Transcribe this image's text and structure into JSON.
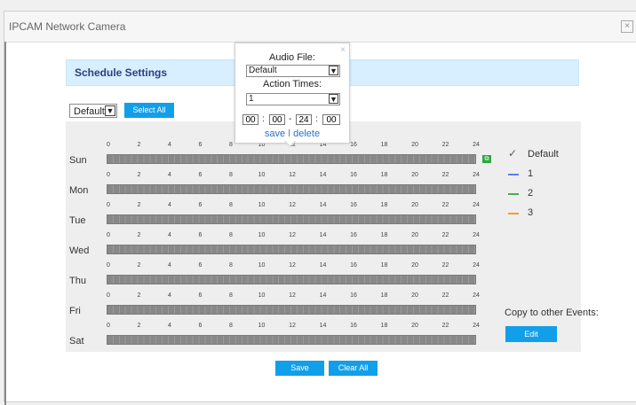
{
  "window": {
    "title": "IPCAM Network Camera",
    "close_glyph": "×"
  },
  "schedule": {
    "header": "Schedule Settings",
    "preset_select": "Default",
    "select_all": "Select All",
    "days": [
      "Sun",
      "Mon",
      "Tue",
      "Wed",
      "Thu",
      "Fri",
      "Sat"
    ],
    "ticks": [
      "0",
      "2",
      "4",
      "6",
      "8",
      "10",
      "12",
      "14",
      "16",
      "18",
      "20",
      "22",
      "24"
    ],
    "copy_icon": "copy-icon"
  },
  "legend": {
    "items": [
      {
        "label": "Default",
        "color": "#5a5a5a",
        "icon": "check-icon"
      },
      {
        "label": "1",
        "color": "#5b7ff0"
      },
      {
        "label": "2",
        "color": "#3db24a"
      },
      {
        "label": "3",
        "color": "#f0a030"
      }
    ],
    "copy_label": "Copy to other Events:",
    "edit_button": "Edit"
  },
  "popup": {
    "close": "×",
    "audio_file_label": "Audio File:",
    "audio_file_value": "Default",
    "action_times_label": "Action Times:",
    "action_times_value": "1",
    "start_hour": "00",
    "start_min": "00",
    "end_hour": "24",
    "end_min": "00",
    "colon": ":",
    "dash": "-",
    "save": "save",
    "divider": "|",
    "delete": "delete"
  },
  "footer": {
    "save_button": "Save",
    "clear_all_button": "Clear All"
  }
}
